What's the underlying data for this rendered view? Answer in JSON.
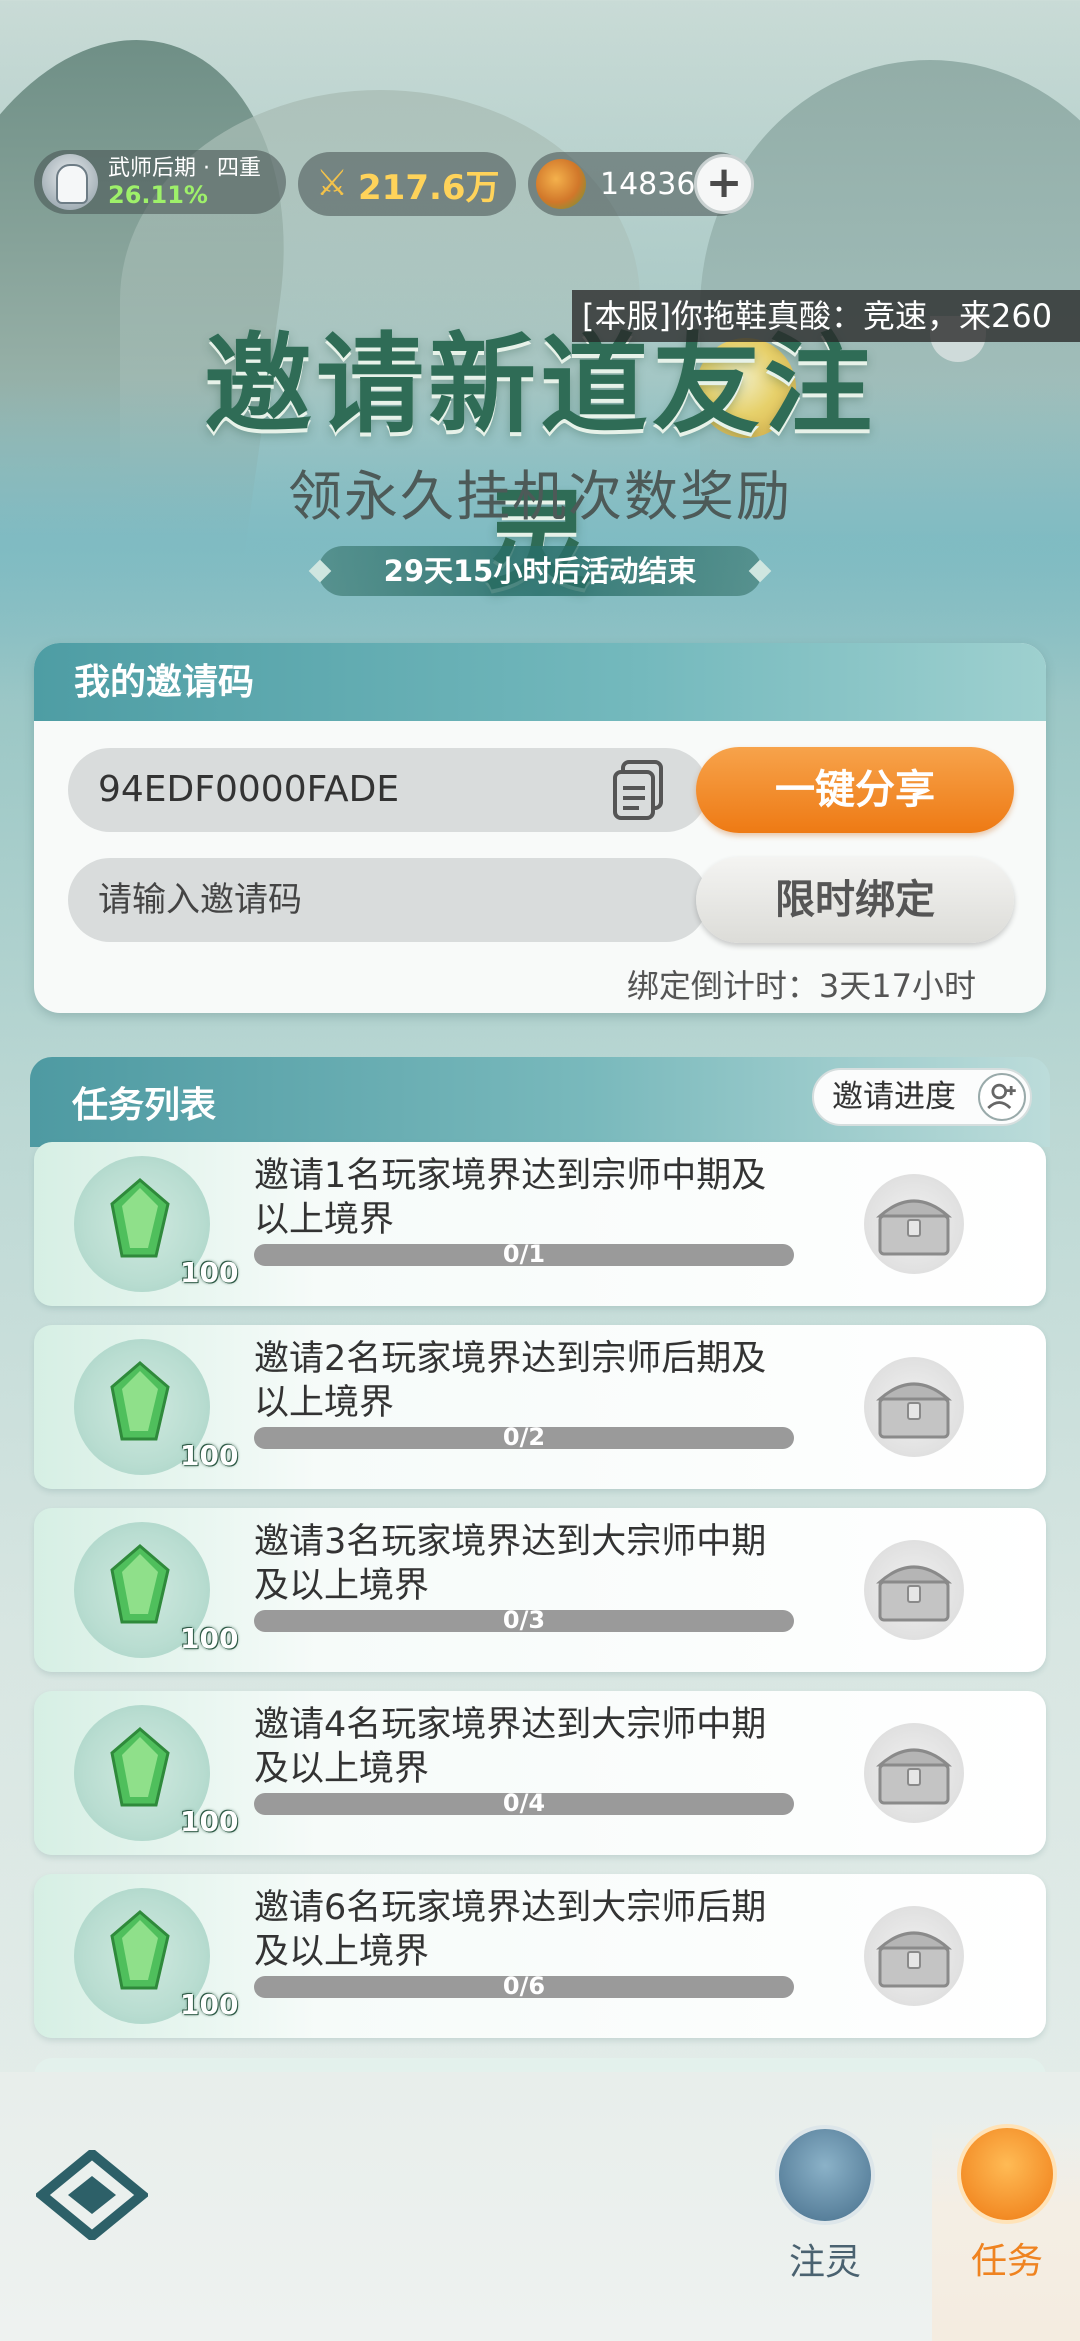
{
  "status": {
    "rank_title": "武师后期 · 四重",
    "rank_percent": "26.11%",
    "power": "217.6万",
    "currency": "14836",
    "add_label": "+"
  },
  "marquee": "[本服]你拖鞋真酸：竞速，来260",
  "banner": {
    "title": "邀请新道友注灵",
    "subtitle": "领永久挂机次数奖励",
    "countdown": "29天15小时后活动结束"
  },
  "invite": {
    "header": "我的邀请码",
    "code": "94EDF0000FADE",
    "share_label": "一键分享",
    "input_placeholder": "请输入邀请码",
    "bind_label": "限时绑定",
    "bind_countdown": "绑定倒计时：3天17小时"
  },
  "tasks": {
    "header": "任务列表",
    "progress_label": "邀请进度",
    "items": [
      {
        "desc": "邀请1名玩家境界达到宗师中期及以上境界",
        "reward_qty": "100",
        "progress_text": "0/1",
        "progress": 0
      },
      {
        "desc": "邀请2名玩家境界达到宗师后期及以上境界",
        "reward_qty": "100",
        "progress_text": "0/2",
        "progress": 0
      },
      {
        "desc": "邀请3名玩家境界达到大宗师中期及以上境界",
        "reward_qty": "100",
        "progress_text": "0/3",
        "progress": 0
      },
      {
        "desc": "邀请4名玩家境界达到大宗师中期及以上境界",
        "reward_qty": "100",
        "progress_text": "0/4",
        "progress": 0
      },
      {
        "desc": "邀请6名玩家境界达到大宗师后期及以上境界",
        "reward_qty": "100",
        "progress_text": "0/6",
        "progress": 0
      }
    ]
  },
  "nav": {
    "zhuling": "注灵",
    "task": "任务"
  },
  "colors": {
    "accent_orange": "#ee7a14",
    "teal_header": "#4e9da4",
    "progress_track": "#9a9a9a"
  }
}
